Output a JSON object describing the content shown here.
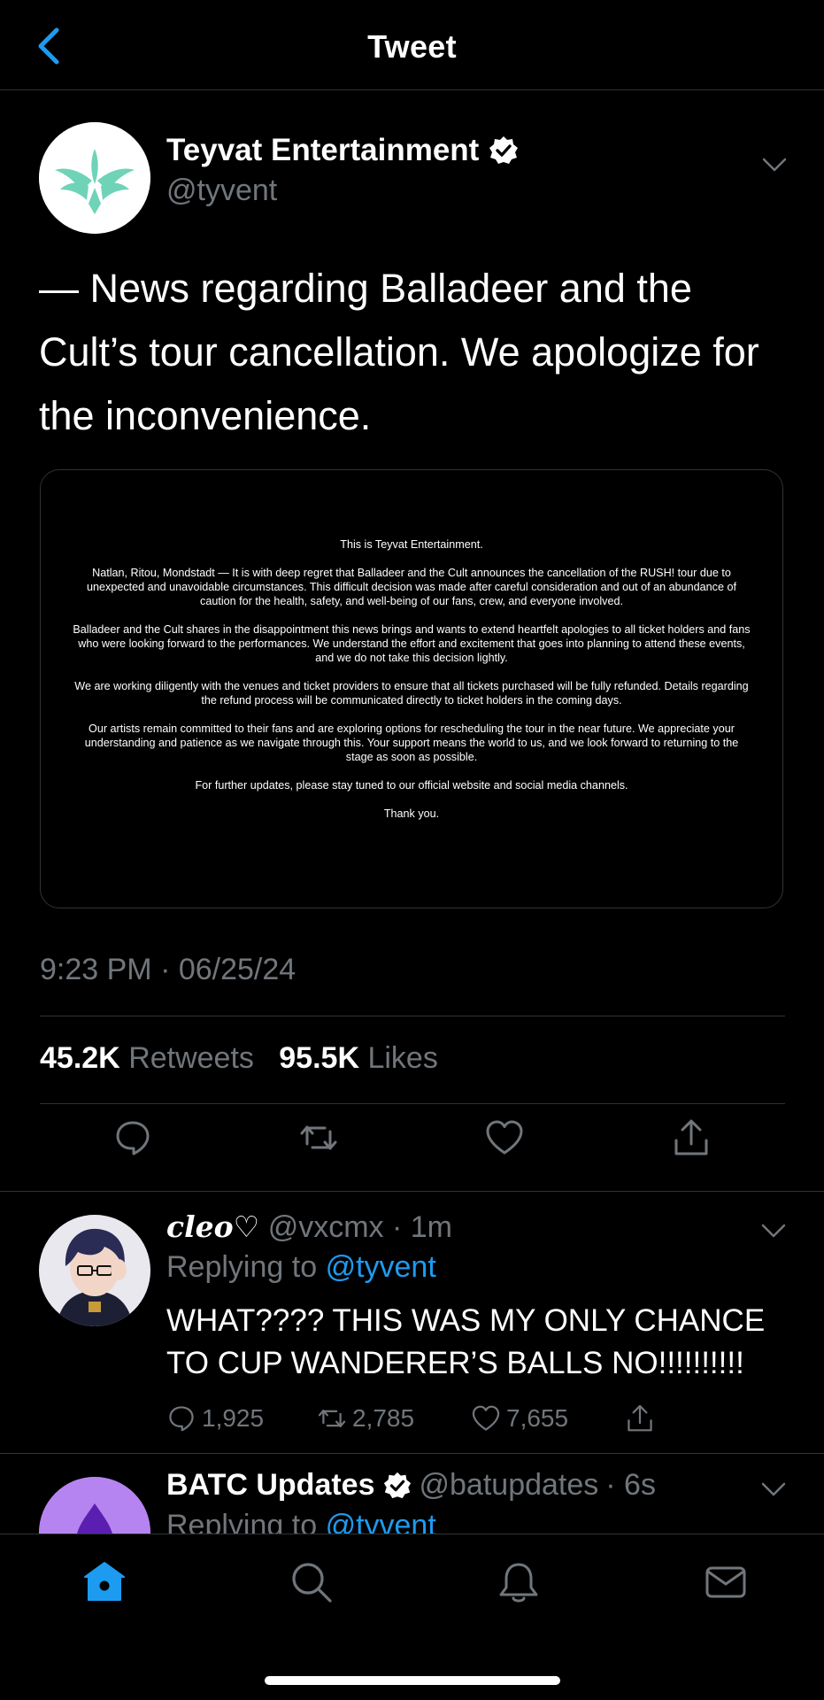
{
  "header": {
    "title": "Tweet",
    "back_icon": "chevron-left-icon"
  },
  "tweet": {
    "author_name": "Teyvat Entertainment",
    "author_handle": "@tyvent",
    "verified": true,
    "text": "— News regarding Balladeer and the Cult’s tour cancellation. We apologize for the inconvenience.",
    "image_notice": {
      "paragraphs": [
        "This is Teyvat Entertainment.",
        "Natlan, Ritou, Mondstadt — It is with deep regret that Balladeer and the Cult announces the cancellation of the RUSH! tour due to unexpected and unavoidable circumstances. This difficult decision was made after careful consideration and out of an abundance of caution for the health, safety, and well-being of our fans, crew, and everyone involved.",
        "Balladeer and the Cult shares in the disappointment this news brings and wants to extend heartfelt apologies to all ticket holders and fans who were looking forward to the performances. We understand the effort and excitement that goes into planning to attend these events, and we do not take this decision lightly.",
        "We are working diligently with the venues and ticket providers to ensure that all tickets purchased will be fully refunded. Details regarding the refund process will be communicated directly to ticket holders in the coming days.",
        "Our artists remain committed to their fans and are exploring options for rescheduling the tour in the near future. We appreciate your understanding and patience as we navigate through this. Your support means the world to us, and we look forward to returning to the stage as soon as possible.",
        "For further updates, please stay tuned to our official website and social media channels.",
        "Thank you."
      ]
    },
    "timestamp": "9:23 PM · 06/25/24",
    "retweets_count": "45.2K",
    "retweets_label": "Retweets",
    "likes_count": "95.5K",
    "likes_label": "Likes"
  },
  "replies": [
    {
      "name": "cleo♡",
      "handle": "@vxcmx",
      "time": "· 1m",
      "replying_prefix": "Replying to",
      "replying_to": "@tyvent",
      "text": "WHAT???? THIS WAS MY ONLY CHANCE TO CUP WANDERER’S BALLS NO!!!!!!!!!!",
      "reply_count": "1,925",
      "retweet_count": "2,785",
      "like_count": "7,655"
    },
    {
      "name": "BATC Updates",
      "handle": "@batupdates",
      "time": "· 6s",
      "verified": true,
      "replying_prefix": "Replying to",
      "replying_to": "@tyvent"
    }
  ],
  "tabbar": {
    "items": [
      "home-icon",
      "search-icon",
      "notifications-bell-icon",
      "messages-envelope-icon"
    ],
    "active": "home-icon"
  },
  "colors": {
    "background": "#000000",
    "accent": "#1d9bf0",
    "muted_text": "#71767b",
    "divider": "#2f3336",
    "logo_teal": "#6fd3b8",
    "batc_purple": "#b684f0"
  }
}
